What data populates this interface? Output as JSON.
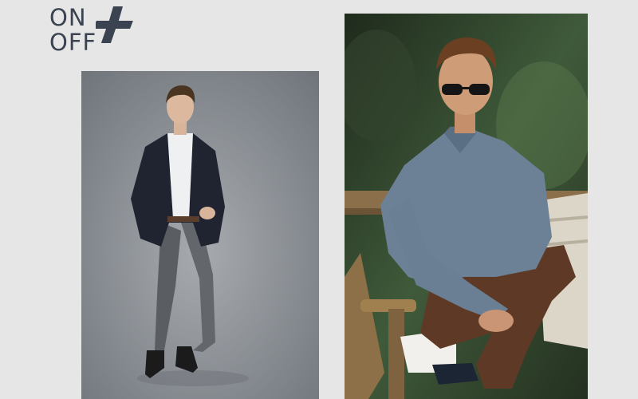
{
  "brand": {
    "line1": "ON",
    "line2": "OFF",
    "mark": "plus-icon",
    "text_color": "#3b4350"
  },
  "photos": [
    {
      "subject": "model-blazer-white-shirt-grey-trousers",
      "background": "#8f949a"
    },
    {
      "subject": "model-sunglasses-blue-shirt-brown-trousers-bench",
      "background": "#2b3a2a"
    }
  ],
  "colors": {
    "page_background": "#e6e6e6"
  }
}
